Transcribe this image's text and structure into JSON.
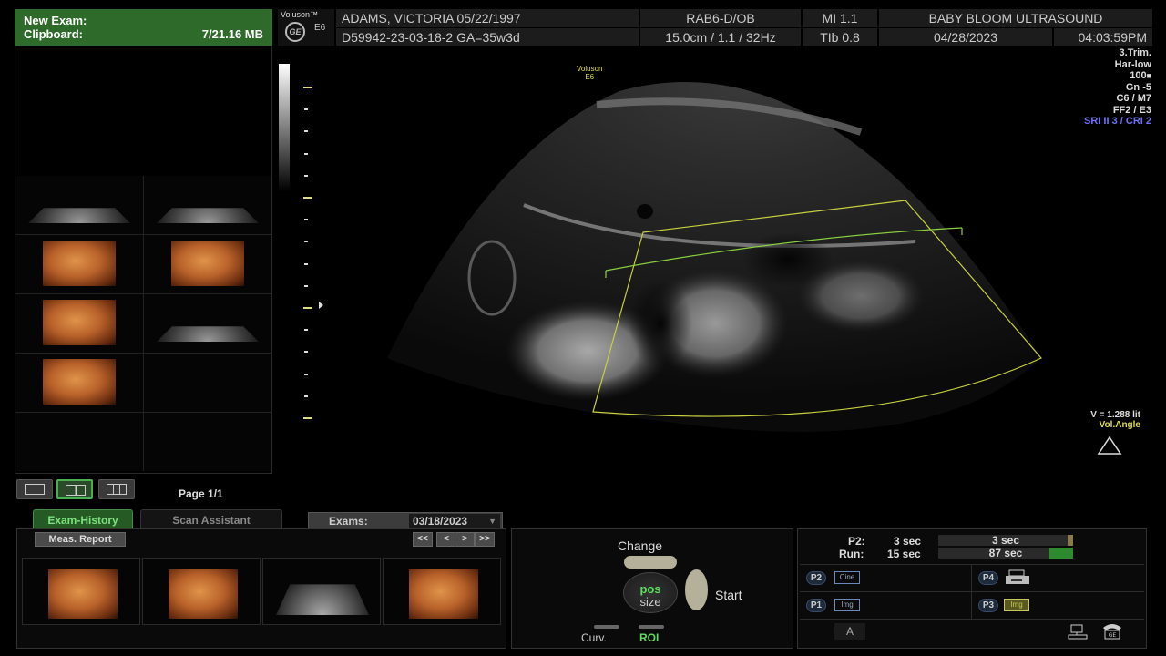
{
  "clipboard": {
    "title": "New Exam:",
    "label": "Clipboard:",
    "size": "7/21.16 MB"
  },
  "page_label": "Page 1/1",
  "header": {
    "brand": "Voluson™",
    "model": "E6",
    "ge": "GE",
    "patient": "ADAMS, VICTORIA  05/22/1997",
    "probe": "RAB6-D/OB",
    "mi": "MI  1.1",
    "clinic": "BABY BLOOM ULTRASOUND",
    "exam_id": "D59942-23-03-18-2  GA=35w3d",
    "depth": "15.0cm / 1.1 / 32Hz",
    "tib": "TIb  0.8",
    "date": "04/28/2023",
    "time": "04:03:59PM"
  },
  "params": [
    "3.Trim.",
    "Har-low",
    "100",
    "Gn  -5",
    "C6 / M7",
    "FF2 / E3"
  ],
  "params_blue": "SRI II 3 / CRI 2",
  "scan_logo": {
    "brand": "Voluson",
    "model": "E6"
  },
  "volume": {
    "value": "V = 1.288 lit",
    "mode": "Vol.Angle"
  },
  "tabs": {
    "history": "Exam-History",
    "scan": "Scan Assistant"
  },
  "exams": {
    "label": "Exams:",
    "date": "03/18/2023"
  },
  "meas_report": "Meas. Report",
  "nav": [
    "<<",
    "<",
    ">",
    ">>"
  ],
  "trackball": {
    "change": "Change",
    "start": "Start",
    "pos": "pos",
    "size": "size",
    "curv": "Curv.",
    "roi": "ROI"
  },
  "cine": {
    "p2_label": "P2:",
    "p2_value": "3 sec",
    "p2_bar": "3 sec",
    "run_label": "Run:",
    "run_value": "15 sec",
    "run_bar": "87 sec"
  },
  "presets": {
    "p2": "P2",
    "p2_icon": "Cine",
    "p4": "P4",
    "p1": "P1",
    "p1_icon": "Img",
    "p3": "P3",
    "p3_icon": "Img"
  },
  "a_label": "A",
  "colors": {
    "accent_green": "#4caf50",
    "roi_yellow": "#dede40",
    "blue_param": "#6f6fff"
  }
}
